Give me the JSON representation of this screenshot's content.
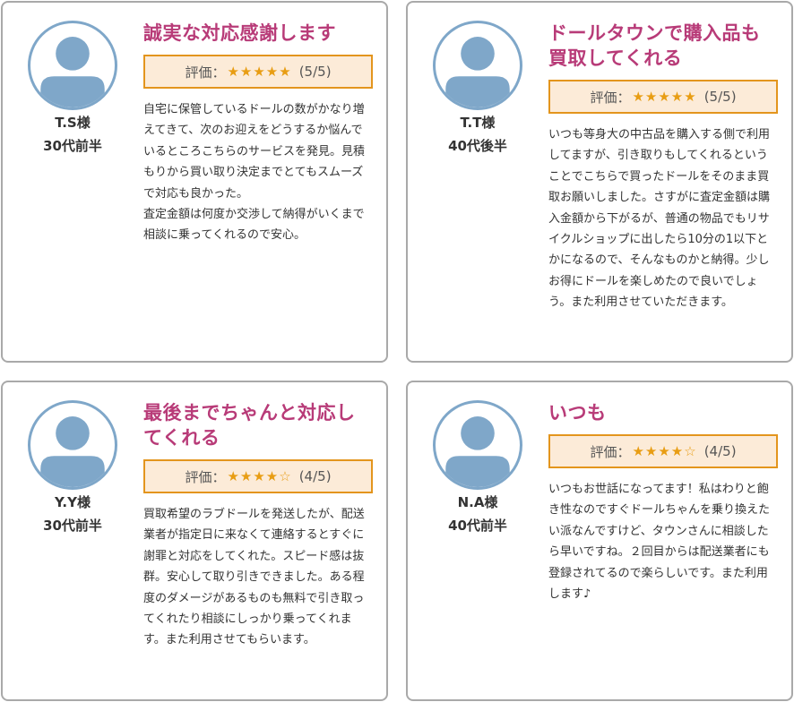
{
  "colors": {
    "title": "#b83b78",
    "rating_border": "#e3951d",
    "rating_bg": "#fcebd8",
    "star": "#e89d13",
    "avatar": "#7fa7c9",
    "card_border": "#a9a9a9"
  },
  "reviews": [
    {
      "avatar_icon": "user-silhouette-icon",
      "name": "T.S様",
      "age": "30代前半",
      "title": "誠実な対応感謝します",
      "rating_label": "評価：",
      "stars": "★★★★★",
      "score": "(5/5)",
      "body": "自宅に保管しているドールの数がかなり増えてきて、次のお迎えをどうするか悩んでいるところこちらのサービスを発見。見積もりから買い取り決定までとてもスムーズで対応も良かった。\n査定金額は何度か交渉して納得がいくまで相談に乗ってくれるので安心。"
    },
    {
      "avatar_icon": "user-silhouette-icon",
      "name": "T.T様",
      "age": "40代後半",
      "title": "ドールタウンで購入品も買取してくれる",
      "rating_label": "評価：",
      "stars": "★★★★★",
      "score": "(5/5)",
      "body": "いつも等身大の中古品を購入する側で利用してますが、引き取りもしてくれるということでこちらで買ったドールをそのまま買取お願いしました。さすがに査定金額は購入金額から下がるが、普通の物品でもリサイクルショップに出したら10分の1以下とかになるので、そんなものかと納得。少しお得にドールを楽しめたので良いでしょう。また利用させていただきます。"
    },
    {
      "avatar_icon": "user-silhouette-icon",
      "name": "Y.Y様",
      "age": "30代前半",
      "title": "最後までちゃんと対応してくれる",
      "rating_label": "評価：",
      "stars": "★★★★☆",
      "score": "(4/5)",
      "body": "買取希望のラブドールを発送したが、配送業者が指定日に来なくて連絡するとすぐに謝罪と対応をしてくれた。スピード感は抜群。安心して取り引きできました。ある程度のダメージがあるものも無料で引き取ってくれたり相談にしっかり乗ってくれます。また利用させてもらいます。"
    },
    {
      "avatar_icon": "user-silhouette-icon",
      "name": "N.A様",
      "age": "40代前半",
      "title": "いつも",
      "rating_label": "評価：",
      "stars": "★★★★☆",
      "score": "(4/5)",
      "body": "いつもお世話になってます！私はわりと飽き性なのですぐドールちゃんを乗り換えたい派なんですけど、タウンさんに相談したら早いですね。２回目からは配送業者にも登録されてるので楽らしいです。また利用します♪"
    }
  ]
}
